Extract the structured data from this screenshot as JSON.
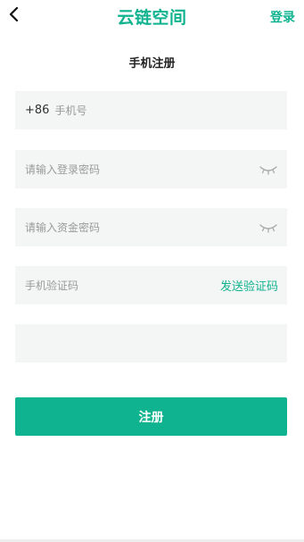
{
  "header": {
    "back_icon": "chevron-left-icon",
    "app_title": "云链空间",
    "login_label": "登录"
  },
  "page_title": "手机注册",
  "form": {
    "phone": {
      "country_code": "+86",
      "placeholder": "手机号",
      "value": ""
    },
    "login_password": {
      "placeholder": "请输入登录密码",
      "value": "",
      "toggle_icon": "eye-closed-icon"
    },
    "fund_password": {
      "placeholder": "请输入资金密码",
      "value": "",
      "toggle_icon": "eye-closed-icon"
    },
    "sms_code": {
      "placeholder": "手机验证码",
      "value": "",
      "send_label": "发送验证码"
    },
    "extra_field": {
      "placeholder": "",
      "value": ""
    },
    "submit_label": "注册"
  },
  "colors": {
    "accent": "#10b38f",
    "field_bg": "#f4f5f5"
  }
}
